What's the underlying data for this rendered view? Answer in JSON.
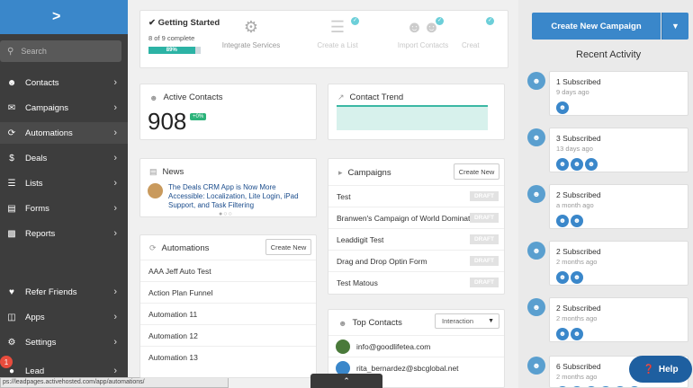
{
  "sidebar": {
    "logo": ">",
    "search_placeholder": "Search",
    "items": [
      {
        "label": "Contacts",
        "icon": "contacts-icon"
      },
      {
        "label": "Campaigns",
        "icon": "envelope-icon"
      },
      {
        "label": "Automations",
        "icon": "automations-icon"
      },
      {
        "label": "Deals",
        "icon": "dollar-icon"
      },
      {
        "label": "Lists",
        "icon": "list-icon"
      },
      {
        "label": "Forms",
        "icon": "forms-icon"
      },
      {
        "label": "Reports",
        "icon": "reports-icon"
      },
      {
        "label": "Refer Friends",
        "icon": "heart-icon"
      },
      {
        "label": "Apps",
        "icon": "apps-icon"
      },
      {
        "label": "Settings",
        "icon": "gear-icon"
      },
      {
        "label": "Lead",
        "icon": "lead-icon"
      }
    ],
    "lead_badge": "1",
    "status_url": "ps://leadpages.activehosted.com/app/automations/"
  },
  "getting_started": {
    "title": "Getting Started",
    "subtitle": "8 of 9 complete",
    "progress_label": "89%",
    "progress": 0.89,
    "steps": [
      "Integrate Services",
      "Create a List",
      "Import Contacts",
      "Creat"
    ]
  },
  "active_contacts": {
    "title": "Active Contacts",
    "count": "908",
    "badge": "+0%"
  },
  "contact_trend": {
    "title": "Contact Trend"
  },
  "news": {
    "title": "News",
    "headline": "The Deals CRM App is Now More Accessible: Localization, Lite Login, iPad Support, and Task Filtering"
  },
  "campaigns": {
    "title": "Campaigns",
    "create_label": "Create New",
    "rows": [
      {
        "name": "Test",
        "status": "DRAFT"
      },
      {
        "name": "Branwen's Campaign of World Domination",
        "status": "DRAFT"
      },
      {
        "name": "Leaddigit Test",
        "status": "DRAFT"
      },
      {
        "name": "Drag and Drop Optin Form",
        "status": "DRAFT"
      },
      {
        "name": "Test Matous",
        "status": "DRAFT"
      }
    ]
  },
  "automations": {
    "title": "Automations",
    "create_label": "Create New",
    "rows": [
      "AAA Jeff Auto Test",
      "Action Plan Funnel",
      "Automation 11",
      "Automation 12",
      "Automation 13"
    ]
  },
  "top_contacts": {
    "title": "Top Contacts",
    "filter": "Interaction",
    "rows": [
      "info@goodlifetea.com",
      "rita_bernardez@sbcglobal.net"
    ]
  },
  "right": {
    "create_button": "Create New Campaign",
    "recent_title": "Recent Activity",
    "activities": [
      {
        "title": "1 Subscribed",
        "time": "9 days ago",
        "avatars": 1
      },
      {
        "title": "3 Subscribed",
        "time": "13 days ago",
        "avatars": 3
      },
      {
        "title": "2 Subscribed",
        "time": "a month ago",
        "avatars": 2
      },
      {
        "title": "2 Subscribed",
        "time": "2 months ago",
        "avatars": 2
      },
      {
        "title": "2 Subscribed",
        "time": "2 months ago",
        "avatars": 2
      },
      {
        "title": "6 Subscribed",
        "time": "2 months ago",
        "avatars": 6
      }
    ],
    "help": "Help"
  },
  "colors": {
    "brand_blue": "#3a87ca",
    "sidebar": "#3d3d3d",
    "teal": "#2cb3a5",
    "draft": "#e2e2e2"
  }
}
